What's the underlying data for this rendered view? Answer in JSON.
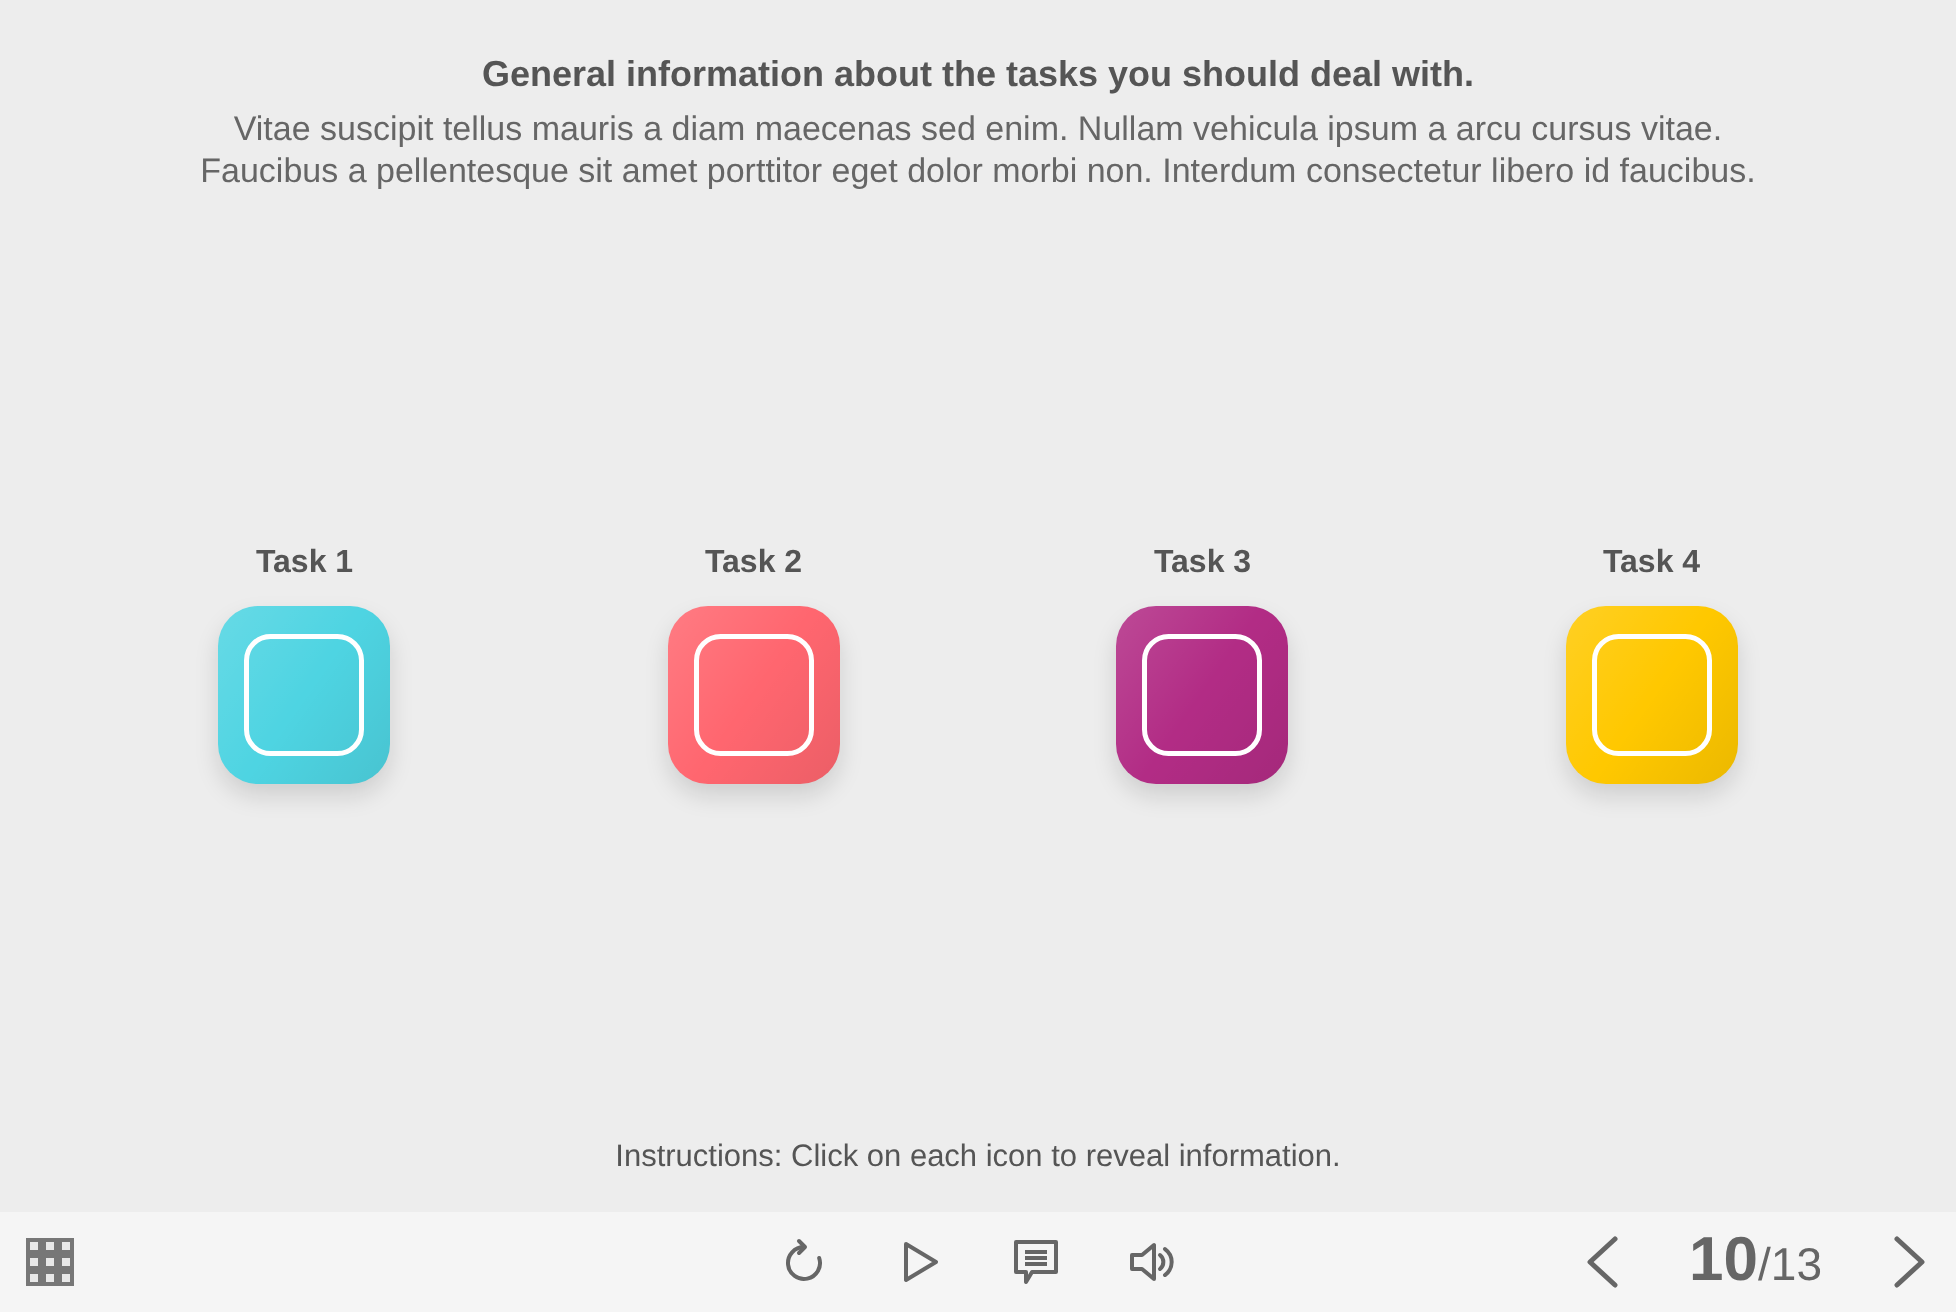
{
  "header": {
    "title": "General information about the tasks you should deal with.",
    "description_lines": [
      "Vitae suscipit tellus mauris a diam maecenas sed enim. Nullam vehicula ipsum a arcu cursus vitae.",
      "Faucibus a pellentesque sit amet porttitor eget dolor morbi non. Interdum consectetur libero id faucibus."
    ]
  },
  "tasks": [
    {
      "label": "Task 1",
      "color": "#4ed4e2"
    },
    {
      "label": "Task 2",
      "color": "#ff666f"
    },
    {
      "label": "Task 3",
      "color": "#b22c85"
    },
    {
      "label": "Task 4",
      "color": "#ffc800"
    }
  ],
  "instructions": "Instructions: Click on each icon to reveal information.",
  "pager": {
    "current": "10",
    "total": "/13"
  }
}
